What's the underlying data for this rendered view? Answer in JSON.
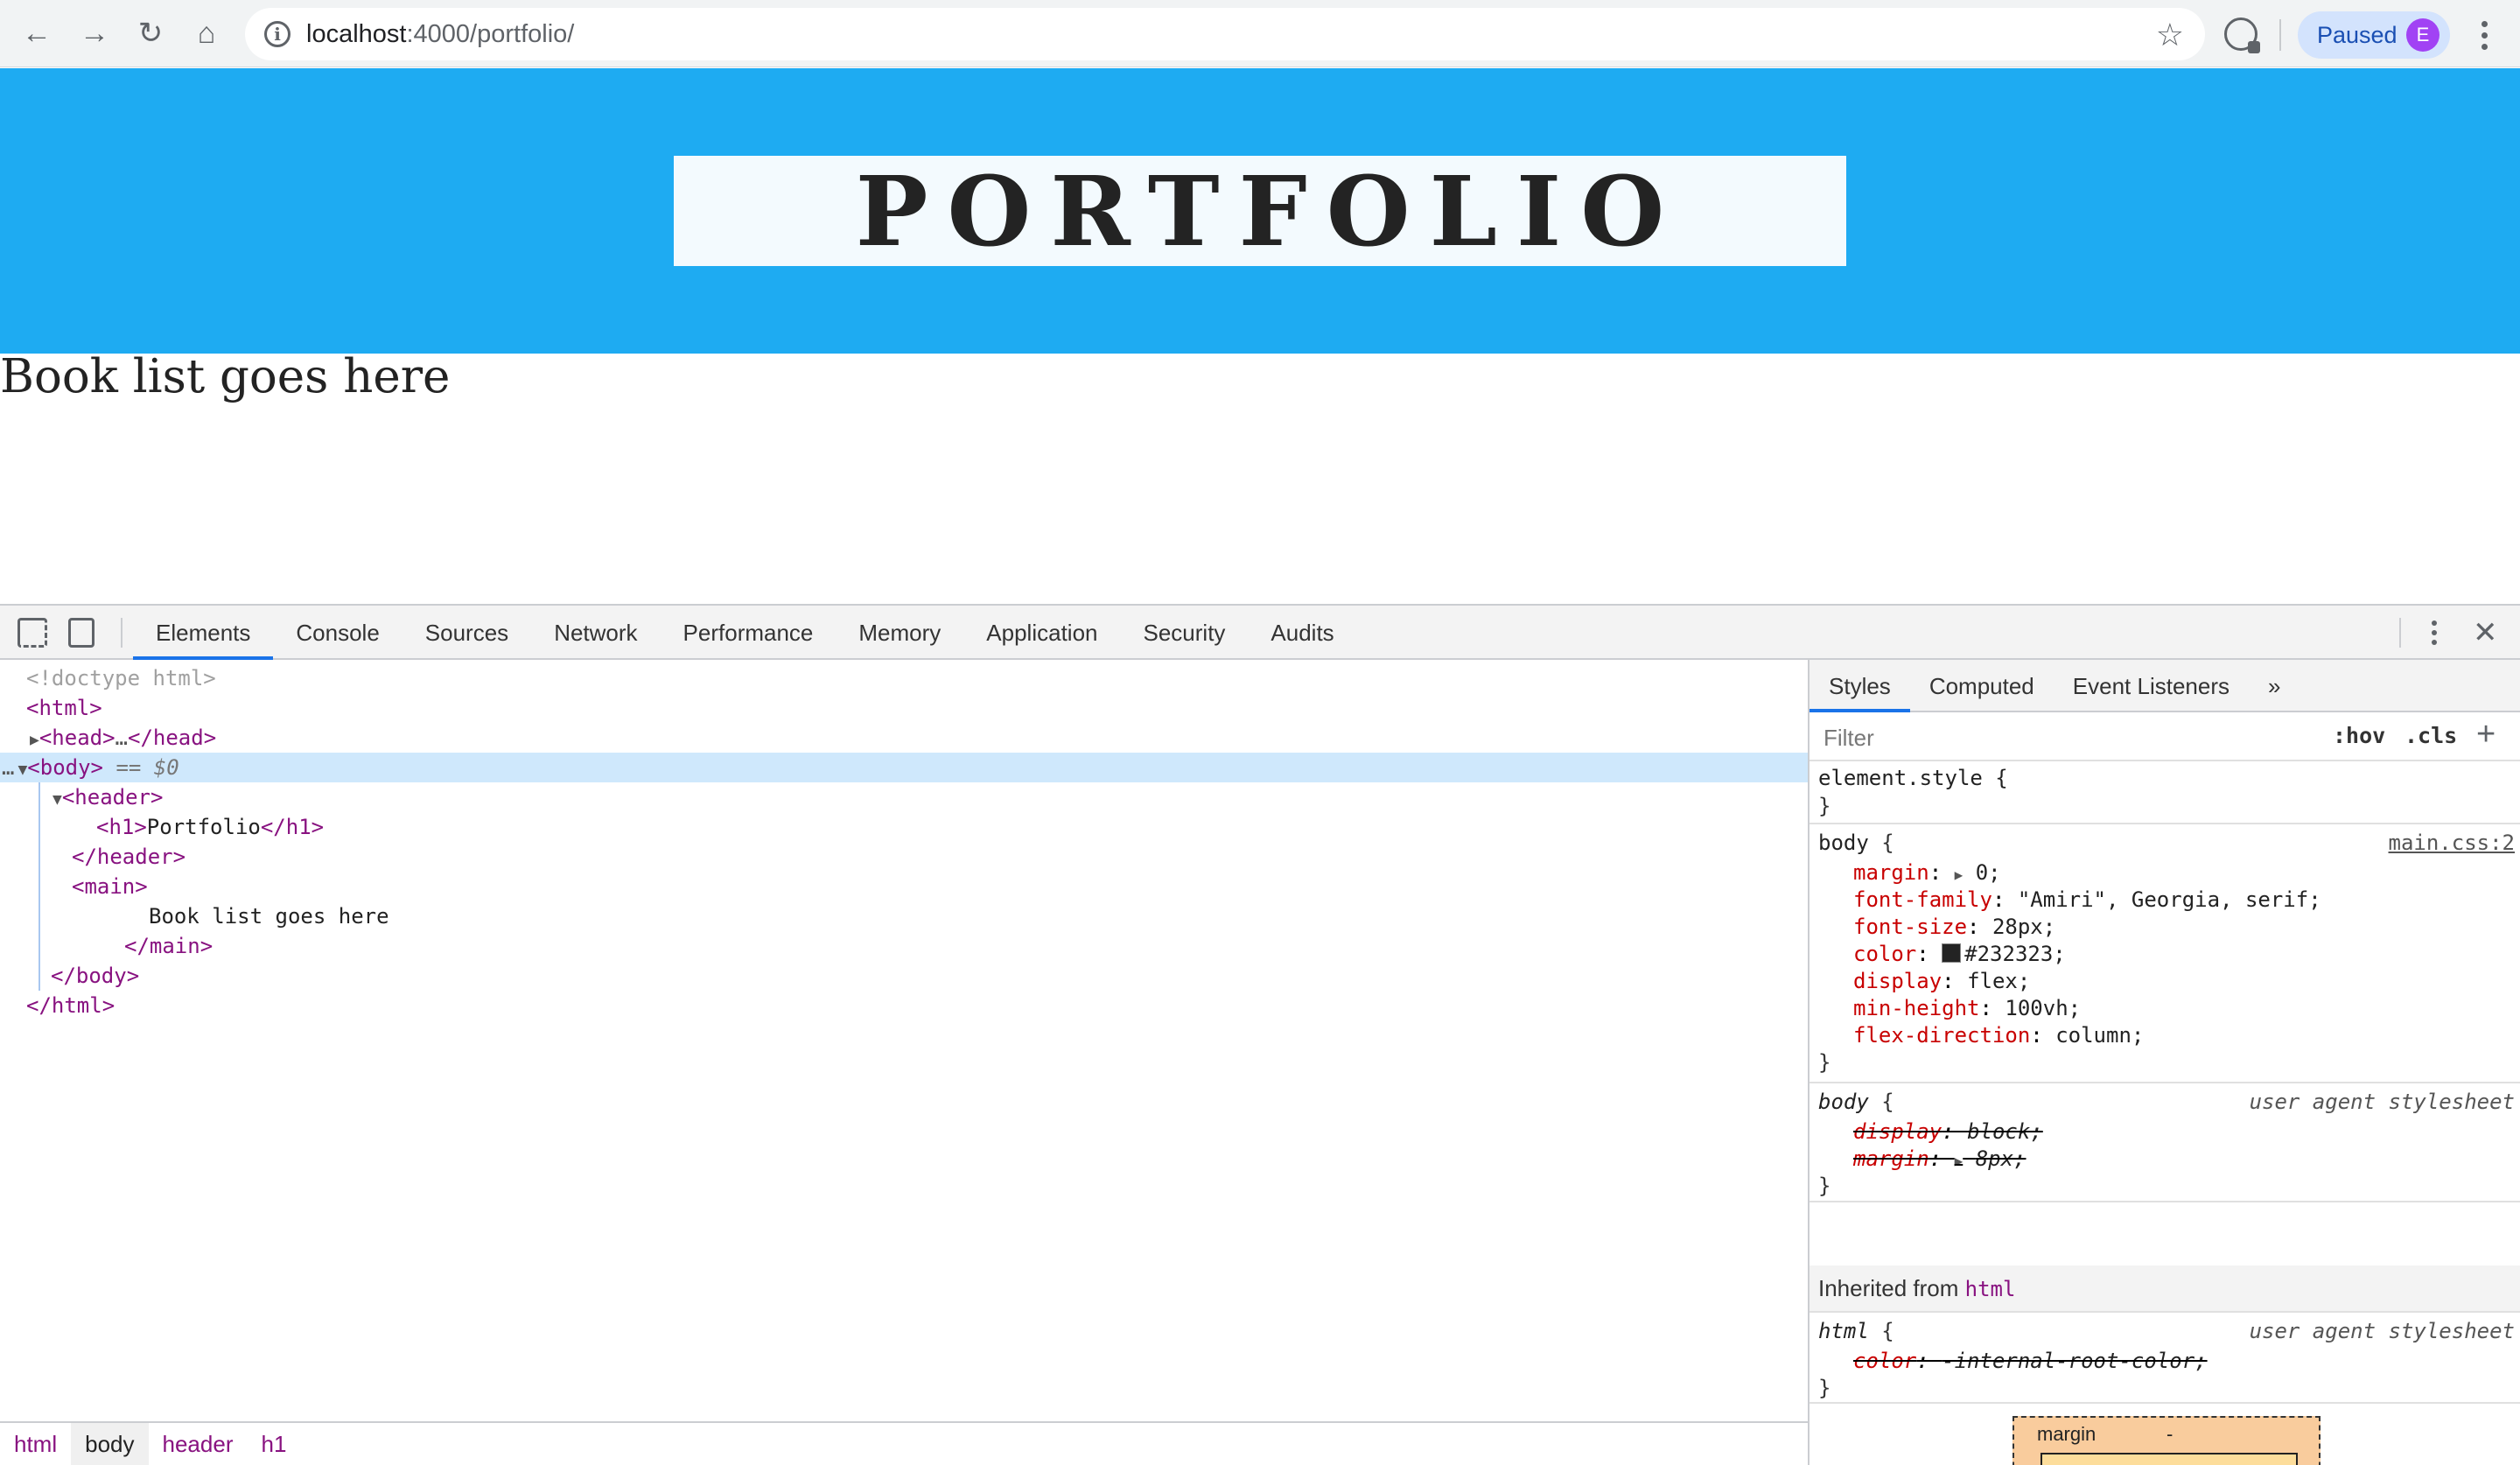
{
  "browser": {
    "url_host": "localhost",
    "url_path": ":4000/portfolio/",
    "profile_label": "Paused",
    "profile_initial": "E"
  },
  "page": {
    "header_title": "PORTFOLIO",
    "main_text": "Book list goes here"
  },
  "devtools": {
    "tabs": [
      "Elements",
      "Console",
      "Sources",
      "Network",
      "Performance",
      "Memory",
      "Application",
      "Security",
      "Audits"
    ],
    "active_tab": "Elements",
    "dom": {
      "doctype": "<!doctype html>",
      "html_open": "<html>",
      "head_open": "<head>",
      "head_ellipsis": "…",
      "head_close": "</head>",
      "body_open": "<body>",
      "body_eq": " == $0",
      "header_open": "<header>",
      "h1_open": "<h1>",
      "h1_text": "Portfolio",
      "h1_close": "</h1>",
      "header_close": "</header>",
      "main_open": "<main>",
      "main_text": "Book list goes here",
      "main_close": "</main>",
      "body_close": "</body>",
      "html_close": "</html>"
    },
    "breadcrumbs": [
      "html",
      "body",
      "header",
      "h1"
    ],
    "styles": {
      "tabs": [
        "Styles",
        "Computed",
        "Event Listeners"
      ],
      "more": "»",
      "filter_placeholder": "Filter",
      "hov": ":hov",
      "cls": ".cls",
      "plus": "+",
      "element_style": "element.style {",
      "close_brace": "}",
      "rule1": {
        "selector": "body",
        "source": "main.css:2",
        "decls": [
          {
            "prop": "margin",
            "val": "0;"
          },
          {
            "prop": "font-family",
            "val": "\"Amiri\", Georgia, serif;"
          },
          {
            "prop": "font-size",
            "val": "28px;"
          },
          {
            "prop": "color",
            "val": "#232323;"
          },
          {
            "prop": "display",
            "val": "flex;"
          },
          {
            "prop": "min-height",
            "val": "100vh;"
          },
          {
            "prop": "flex-direction",
            "val": "column;"
          }
        ]
      },
      "rule2": {
        "selector": "body",
        "source": "user agent stylesheet",
        "decls": [
          {
            "prop": "display",
            "val": "block;"
          },
          {
            "prop": "margin",
            "val": "8px;"
          }
        ]
      },
      "inherited_label": "Inherited from",
      "inherited_tag": "html",
      "rule3": {
        "selector": "html",
        "source": "user agent stylesheet",
        "decls": [
          {
            "prop": "color",
            "val": "-internal-root-color;"
          }
        ]
      },
      "box_model": {
        "label": "margin",
        "value": "-"
      }
    }
  },
  "colors": {
    "header_bg": "#1eabf2",
    "text": "#232323",
    "accent": "#1a73e8"
  }
}
